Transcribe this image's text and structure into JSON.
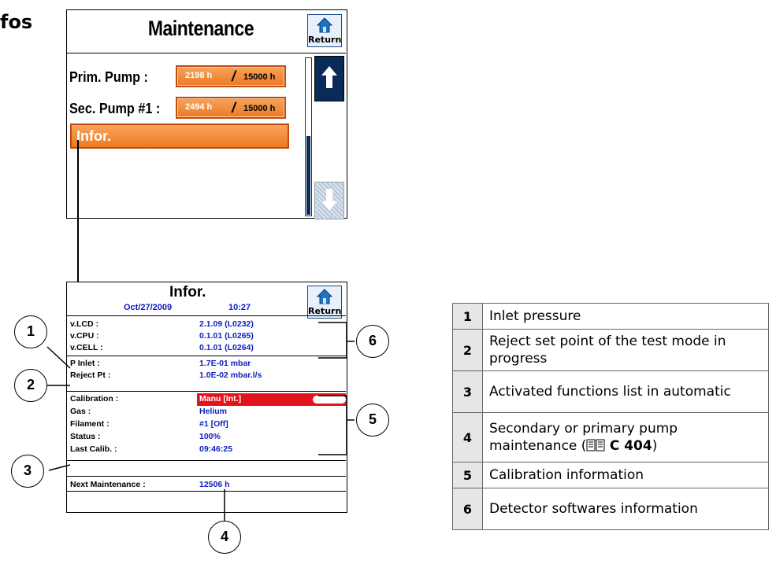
{
  "heading": "fos",
  "maintenance_screen": {
    "title": "Maintenance",
    "return_label": "Return",
    "pumps": [
      {
        "label": "Prim. Pump :",
        "current": "2198 h",
        "separator": "/",
        "limit": "15000 h"
      },
      {
        "label": "Sec. Pump #1 :",
        "current": "2494 h",
        "separator": "/",
        "limit": "15000 h"
      }
    ],
    "infor_button": "Infor."
  },
  "infor_screen": {
    "title": "Infor.",
    "date": "Oct/27/2009",
    "time": "10:27",
    "return_label": "Return",
    "rows": [
      {
        "label": "v.LCD :",
        "value": "2.1.09  (L0232)"
      },
      {
        "label": "v.CPU :",
        "value": "0.1.01  (L0265)"
      },
      {
        "label": "v.CELL :",
        "value": "0.1.01  (L0264)"
      },
      {
        "label": "P Inlet :",
        "value": "1.7E-01 mbar"
      },
      {
        "label": "Reject Pt :",
        "value": "1.0E-02 mbar.l/s"
      },
      {
        "label": "Calibration :",
        "value": "Manu [Int.]"
      },
      {
        "label": "Gas :",
        "value": "Helium"
      },
      {
        "label": "Filament :",
        "value": "#1 [Off]"
      },
      {
        "label": "Status :",
        "value": "100%"
      },
      {
        "label": "Last Calib. :",
        "value": "09:46:25"
      },
      {
        "label": "Next Maintenance :",
        "value": "12506 h"
      }
    ]
  },
  "callouts": [
    "1",
    "2",
    "3",
    "4",
    "5",
    "6"
  ],
  "legend": [
    {
      "num": "1",
      "text": "Inlet pressure"
    },
    {
      "num": "2",
      "text": "Reject set point of the test mode in progress"
    },
    {
      "num": "3",
      "text": "Activated functions list in automatic"
    },
    {
      "num": "4",
      "text": "Secondary or primary pump maintenance (",
      "ref": "C 404",
      "suffix": ")"
    },
    {
      "num": "5",
      "text": "Calibration information"
    },
    {
      "num": "6",
      "text": "Detector softwares information"
    }
  ],
  "colors": {
    "orange": "#ec7a26",
    "navy": "#0a2a5a",
    "blue_text": "#1020c0",
    "red": "#e4131b"
  }
}
